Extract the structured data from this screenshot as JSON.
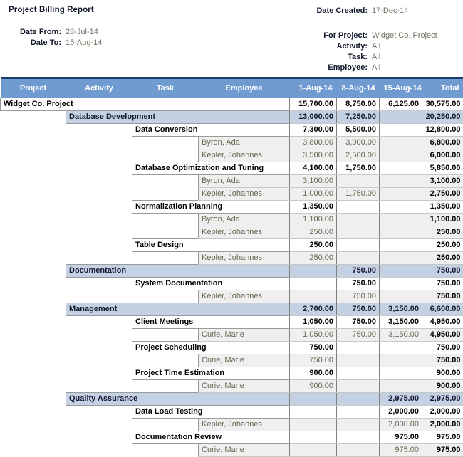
{
  "header": {
    "title": "Project Billing Report",
    "left_meta": [
      {
        "label": "Date From:",
        "value": "28-Jul-14"
      },
      {
        "label": "Date To:",
        "value": "15-Aug-14"
      }
    ],
    "created": {
      "label": "Date Created:",
      "value": "17-Dec-14"
    },
    "right_meta": [
      {
        "label": "For Project:",
        "value": "Widget Co. Project"
      },
      {
        "label": "Activity:",
        "value": "All"
      },
      {
        "label": "Task:",
        "value": "All"
      },
      {
        "label": "Employee:",
        "value": "All"
      }
    ]
  },
  "colors": {
    "header_blue": "#6f9bd1",
    "header_rule": "#1b3d6d",
    "activity_band": "#c3d1e2",
    "employee_band": "#efefef",
    "value_text": "#6e7360"
  },
  "table": {
    "columns": [
      {
        "key": "project",
        "label": "Project",
        "align": "center"
      },
      {
        "key": "activity",
        "label": "Activity",
        "align": "center"
      },
      {
        "key": "task",
        "label": "Task",
        "align": "center"
      },
      {
        "key": "employee",
        "label": "Employee",
        "align": "center"
      },
      {
        "key": "w1",
        "label": "1-Aug-14",
        "align": "right"
      },
      {
        "key": "w2",
        "label": "8-Aug-14",
        "align": "right"
      },
      {
        "key": "w3",
        "label": "15-Aug-14",
        "align": "right"
      },
      {
        "key": "total",
        "label": "Total",
        "align": "right"
      }
    ],
    "rows": [
      {
        "level": "project",
        "label": "Widget Co. Project",
        "w1": "15,700.00",
        "w2": "8,750.00",
        "w3": "6,125.00",
        "total": "30,575.00"
      },
      {
        "level": "activity",
        "label": "Database Development",
        "w1": "13,000.00",
        "w2": "7,250.00",
        "w3": "",
        "total": "20,250.00"
      },
      {
        "level": "task",
        "label": "Data Conversion",
        "w1": "7,300.00",
        "w2": "5,500.00",
        "w3": "",
        "total": "12,800.00"
      },
      {
        "level": "employee",
        "label": "Byron, Ada",
        "w1": "3,800.00",
        "w2": "3,000.00",
        "w3": "",
        "total": "6,800.00"
      },
      {
        "level": "employee",
        "label": "Kepler, Johannes",
        "w1": "3,500.00",
        "w2": "2,500.00",
        "w3": "",
        "total": "6,000.00"
      },
      {
        "level": "task",
        "label": "Database Optimization and Tuning",
        "w1": "4,100.00",
        "w2": "1,750.00",
        "w3": "",
        "total": "5,850.00"
      },
      {
        "level": "employee",
        "label": "Byron, Ada",
        "w1": "3,100.00",
        "w2": "",
        "w3": "",
        "total": "3,100.00"
      },
      {
        "level": "employee",
        "label": "Kepler, Johannes",
        "w1": "1,000.00",
        "w2": "1,750.00",
        "w3": "",
        "total": "2,750.00"
      },
      {
        "level": "task",
        "label": "Normalization Planning",
        "w1": "1,350.00",
        "w2": "",
        "w3": "",
        "total": "1,350.00"
      },
      {
        "level": "employee",
        "label": "Byron, Ada",
        "w1": "1,100.00",
        "w2": "",
        "w3": "",
        "total": "1,100.00"
      },
      {
        "level": "employee",
        "label": "Kepler, Johannes",
        "w1": "250.00",
        "w2": "",
        "w3": "",
        "total": "250.00"
      },
      {
        "level": "task",
        "label": "Table Design",
        "w1": "250.00",
        "w2": "",
        "w3": "",
        "total": "250.00"
      },
      {
        "level": "employee",
        "label": "Kepler, Johannes",
        "w1": "250.00",
        "w2": "",
        "w3": "",
        "total": "250.00"
      },
      {
        "level": "activity",
        "label": "Documentation",
        "w1": "",
        "w2": "750.00",
        "w3": "",
        "total": "750.00"
      },
      {
        "level": "task",
        "label": "System Documentation",
        "w1": "",
        "w2": "750.00",
        "w3": "",
        "total": "750.00"
      },
      {
        "level": "employee",
        "label": "Kepler, Johannes",
        "w1": "",
        "w2": "750.00",
        "w3": "",
        "total": "750.00"
      },
      {
        "level": "activity",
        "label": "Management",
        "w1": "2,700.00",
        "w2": "750.00",
        "w3": "3,150.00",
        "total": "6,600.00"
      },
      {
        "level": "task",
        "label": "Client Meetings",
        "w1": "1,050.00",
        "w2": "750.00",
        "w3": "3,150.00",
        "total": "4,950.00"
      },
      {
        "level": "employee",
        "label": "Curie, Marie",
        "w1": "1,050.00",
        "w2": "750.00",
        "w3": "3,150.00",
        "total": "4,950.00"
      },
      {
        "level": "task",
        "label": "Project Scheduling",
        "w1": "750.00",
        "w2": "",
        "w3": "",
        "total": "750.00"
      },
      {
        "level": "employee",
        "label": "Curie, Marie",
        "w1": "750.00",
        "w2": "",
        "w3": "",
        "total": "750.00"
      },
      {
        "level": "task",
        "label": "Project Time Estimation",
        "w1": "900.00",
        "w2": "",
        "w3": "",
        "total": "900.00"
      },
      {
        "level": "employee",
        "label": "Curie, Marie",
        "w1": "900.00",
        "w2": "",
        "w3": "",
        "total": "900.00"
      },
      {
        "level": "activity",
        "label": "Quality Assurance",
        "w1": "",
        "w2": "",
        "w3": "2,975.00",
        "total": "2,975.00"
      },
      {
        "level": "task",
        "label": "Data Load Testing",
        "w1": "",
        "w2": "",
        "w3": "2,000.00",
        "total": "2,000.00"
      },
      {
        "level": "employee",
        "label": "Kepler, Johannes",
        "w1": "",
        "w2": "",
        "w3": "2,000.00",
        "total": "2,000.00"
      },
      {
        "level": "task",
        "label": "Documentation Review",
        "w1": "",
        "w2": "",
        "w3": "975.00",
        "total": "975.00"
      },
      {
        "level": "employee",
        "label": "Curie, Marie",
        "w1": "",
        "w2": "",
        "w3": "975.00",
        "total": "975.00"
      }
    ]
  }
}
